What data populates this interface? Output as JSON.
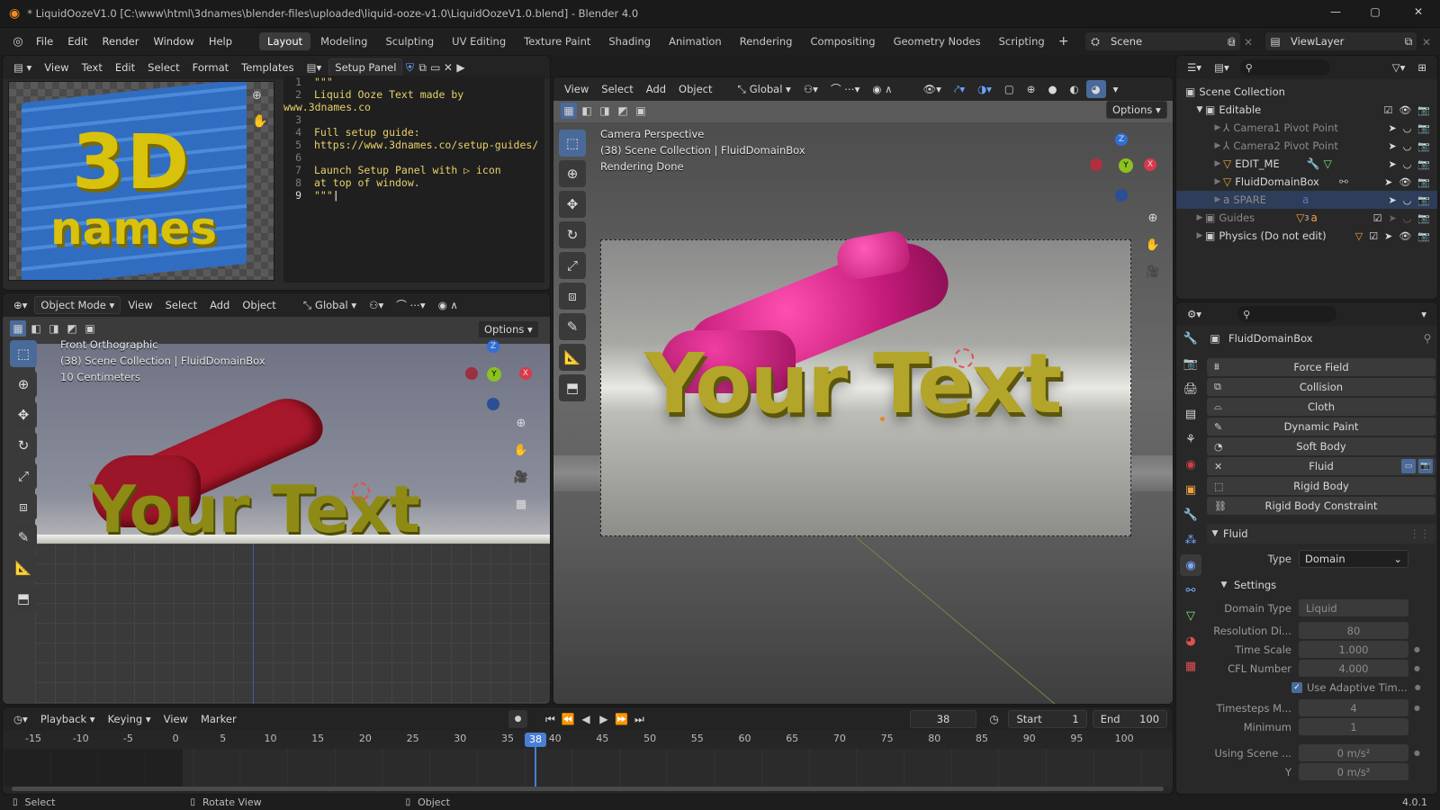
{
  "window": {
    "title": "* LiquidOozeV1.0 [C:\\www\\html\\3dnames\\blender-files\\uploaded\\liquid-ooze-v1.0\\LiquidOozeV1.0.blend] - Blender 4.0"
  },
  "menu": {
    "items": [
      "File",
      "Edit",
      "Render",
      "Window",
      "Help"
    ],
    "workspaces": [
      "Layout",
      "Modeling",
      "Sculpting",
      "UV Editing",
      "Texture Paint",
      "Shading",
      "Animation",
      "Rendering",
      "Compositing",
      "Geometry Nodes",
      "Scripting"
    ],
    "active_workspace": "Layout",
    "scene": "Scene",
    "view_layer": "ViewLayer"
  },
  "text_editor": {
    "menus": [
      "View",
      "Text",
      "Edit",
      "Select",
      "Format",
      "Templates"
    ],
    "file_name": "Setup Panel",
    "lines": [
      {
        "n": "1",
        "t": "\"\"\""
      },
      {
        "n": "2",
        "t": "Liquid Ooze Text made by www.3dnames.co"
      },
      {
        "n": "3",
        "t": ""
      },
      {
        "n": "4",
        "t": "Full setup guide:"
      },
      {
        "n": "5",
        "t": "https://www.3dnames.co/setup-guides/"
      },
      {
        "n": "6",
        "t": ""
      },
      {
        "n": "7",
        "t": "Launch Setup Panel with ▷ icon"
      },
      {
        "n": "8",
        "t": "at top of window."
      },
      {
        "n": "9",
        "t": "\"\"\""
      }
    ]
  },
  "logo": {
    "line1": "3D",
    "line2": "names"
  },
  "left_viewport": {
    "mode": "Object Mode",
    "menus": [
      "View",
      "Select",
      "Add",
      "Object"
    ],
    "orientation": "Global",
    "options_label": "Options",
    "overlay_lines": [
      "Front Orthographic",
      "(38) Scene Collection | FluidDomainBox",
      "10 Centimeters"
    ],
    "scene_text": "Your Text"
  },
  "camera_viewport": {
    "menus": [
      "View",
      "Select",
      "Add",
      "Object"
    ],
    "orientation": "Global",
    "options_label": "Options",
    "overlay_lines": [
      "Camera Perspective",
      "(38) Scene Collection | FluidDomainBox",
      "Rendering Done"
    ],
    "scene_text": "Your Text"
  },
  "outliner": {
    "root": "Scene Collection",
    "rows": [
      {
        "label": "Editable",
        "indent": 1,
        "type": "collection"
      },
      {
        "label": "Camera1 Pivot Point",
        "indent": 2,
        "type": "empty",
        "dim": true
      },
      {
        "label": "Camera2 Pivot Point",
        "indent": 2,
        "type": "empty",
        "dim": true
      },
      {
        "label": "EDIT_ME",
        "indent": 2,
        "type": "mesh"
      },
      {
        "label": "FluidDomainBox",
        "indent": 2,
        "type": "mesh"
      },
      {
        "label": "SPARE",
        "indent": 2,
        "type": "text",
        "dim": true,
        "selected": true
      },
      {
        "label": "Guides",
        "indent": 1,
        "type": "collection",
        "dim": true
      },
      {
        "label": "Physics (Do not edit)",
        "indent": 1,
        "type": "collection"
      }
    ],
    "guides_badge": "3"
  },
  "properties": {
    "object_name": "FluidDomainBox",
    "physics_buttons": [
      "Force Field",
      "Collision",
      "Cloth",
      "Dynamic Paint",
      "Soft Body",
      "Fluid",
      "Rigid Body",
      "Rigid Body Constraint"
    ],
    "fluid_panel": "Fluid",
    "type_label": "Type",
    "type_value": "Domain",
    "settings_panel": "Settings",
    "rows": [
      {
        "label": "Domain Type",
        "value": "Liquid"
      },
      {
        "label": "Resolution Di...",
        "value": "80"
      },
      {
        "label": "Time Scale",
        "value": "1.000"
      },
      {
        "label": "CFL Number",
        "value": "4.000"
      }
    ],
    "adaptive_label": "Use Adaptive Tim...",
    "rows2": [
      {
        "label": "Timesteps M...",
        "value": "4"
      },
      {
        "label": "Minimum",
        "value": "1"
      }
    ],
    "rows3": [
      {
        "label": "Using Scene ...",
        "value": "0 m/s²"
      },
      {
        "label": "Y",
        "value": "0 m/s²"
      }
    ]
  },
  "timeline": {
    "menus": [
      "Playback",
      "Keying",
      "View",
      "Marker"
    ],
    "current_frame": "38",
    "start_label": "Start",
    "start": "1",
    "end_label": "End",
    "end": "100",
    "ticks": [
      "-15",
      "-10",
      "-5",
      "0",
      "5",
      "10",
      "15",
      "20",
      "25",
      "30",
      "35",
      "40",
      "45",
      "50",
      "55",
      "60",
      "65",
      "70",
      "75",
      "80",
      "85",
      "90",
      "95",
      "100"
    ]
  },
  "status_bar": {
    "items": [
      "Select",
      "Rotate View",
      "Object"
    ],
    "version": "4.0.1"
  }
}
